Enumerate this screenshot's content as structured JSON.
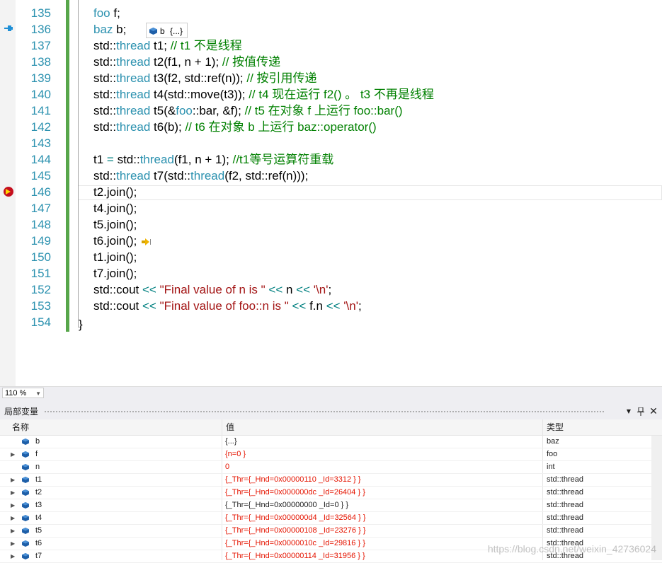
{
  "editor": {
    "lines": [
      {
        "n": "135",
        "segs": [
          {
            "t": "foo",
            "c": "kw"
          },
          {
            "t": " f;",
            "c": ""
          }
        ]
      },
      {
        "n": "136",
        "segs": [
          {
            "t": "baz",
            "c": "kw"
          },
          {
            "t": " b;",
            "c": ""
          }
        ]
      },
      {
        "n": "137",
        "segs": [
          {
            "t": "std::",
            "c": ""
          },
          {
            "t": "thread",
            "c": "kw"
          },
          {
            "t": " t1; ",
            "c": ""
          },
          {
            "t": "// t1 不是线程",
            "c": "cm"
          }
        ]
      },
      {
        "n": "138",
        "segs": [
          {
            "t": "std::",
            "c": ""
          },
          {
            "t": "thread",
            "c": "kw"
          },
          {
            "t": " t2(f1, n + 1); ",
            "c": ""
          },
          {
            "t": "// 按值传递",
            "c": "cm"
          }
        ]
      },
      {
        "n": "139",
        "segs": [
          {
            "t": "std::",
            "c": ""
          },
          {
            "t": "thread",
            "c": "kw"
          },
          {
            "t": " t3(f2, std::ref(n)); ",
            "c": ""
          },
          {
            "t": "// 按引用传递",
            "c": "cm"
          }
        ]
      },
      {
        "n": "140",
        "segs": [
          {
            "t": "std::",
            "c": ""
          },
          {
            "t": "thread",
            "c": "kw"
          },
          {
            "t": " t4(std::move(t3)); ",
            "c": ""
          },
          {
            "t": "// t4 现在运行 f2() 。 t3 不再是线程",
            "c": "cm"
          }
        ]
      },
      {
        "n": "141",
        "segs": [
          {
            "t": "std::",
            "c": ""
          },
          {
            "t": "thread",
            "c": "kw"
          },
          {
            "t": " t5(&",
            "c": ""
          },
          {
            "t": "foo",
            "c": "kw"
          },
          {
            "t": "::bar, &f); ",
            "c": ""
          },
          {
            "t": "// t5 在对象 f 上运行 foo::bar()",
            "c": "cm"
          }
        ]
      },
      {
        "n": "142",
        "segs": [
          {
            "t": "std::",
            "c": ""
          },
          {
            "t": "thread",
            "c": "kw"
          },
          {
            "t": " t6(b); ",
            "c": ""
          },
          {
            "t": "// t6 在对象 b 上运行 baz::operator()",
            "c": "cm"
          }
        ]
      },
      {
        "n": "143",
        "segs": []
      },
      {
        "n": "144",
        "segs": [
          {
            "t": "t1 ",
            "c": ""
          },
          {
            "t": "=",
            "c": "op"
          },
          {
            "t": " std::",
            "c": ""
          },
          {
            "t": "thread",
            "c": "kw"
          },
          {
            "t": "(f1, n + 1); ",
            "c": ""
          },
          {
            "t": "//t1等号运算符重载",
            "c": "cm"
          }
        ]
      },
      {
        "n": "145",
        "segs": [
          {
            "t": "std::",
            "c": ""
          },
          {
            "t": "thread",
            "c": "kw"
          },
          {
            "t": " t7(std::",
            "c": ""
          },
          {
            "t": "thread",
            "c": "kw"
          },
          {
            "t": "(f2, std::ref(n)));",
            "c": ""
          }
        ]
      },
      {
        "n": "146",
        "segs": [
          {
            "t": "t2.join();",
            "c": ""
          }
        ]
      },
      {
        "n": "147",
        "segs": [
          {
            "t": "t4.join();",
            "c": ""
          }
        ]
      },
      {
        "n": "148",
        "segs": [
          {
            "t": "t5.join();",
            "c": ""
          }
        ]
      },
      {
        "n": "149",
        "segs": [
          {
            "t": "t6.join();",
            "c": ""
          }
        ]
      },
      {
        "n": "150",
        "segs": [
          {
            "t": "t1.join();",
            "c": ""
          }
        ]
      },
      {
        "n": "151",
        "segs": [
          {
            "t": "t7.join();",
            "c": ""
          }
        ]
      },
      {
        "n": "152",
        "segs": [
          {
            "t": "std::cout ",
            "c": ""
          },
          {
            "t": "<<",
            "c": "op"
          },
          {
            "t": " ",
            "c": ""
          },
          {
            "t": "\"Final value of n is \"",
            "c": "st"
          },
          {
            "t": " ",
            "c": ""
          },
          {
            "t": "<<",
            "c": "op"
          },
          {
            "t": " n ",
            "c": ""
          },
          {
            "t": "<<",
            "c": "op"
          },
          {
            "t": " ",
            "c": ""
          },
          {
            "t": "'\\n'",
            "c": "st"
          },
          {
            "t": ";",
            "c": ""
          }
        ]
      },
      {
        "n": "153",
        "segs": [
          {
            "t": "std::cout ",
            "c": ""
          },
          {
            "t": "<<",
            "c": "op"
          },
          {
            "t": " ",
            "c": ""
          },
          {
            "t": "\"Final value of foo::n is \"",
            "c": "st"
          },
          {
            "t": " ",
            "c": ""
          },
          {
            "t": "<<",
            "c": "op"
          },
          {
            "t": " f.n ",
            "c": ""
          },
          {
            "t": "<<",
            "c": "op"
          },
          {
            "t": " ",
            "c": ""
          },
          {
            "t": "'\\n'",
            "c": "st"
          },
          {
            "t": ";",
            "c": ""
          }
        ]
      },
      {
        "n": "154",
        "segs": []
      }
    ],
    "closing_brace": "}",
    "datatip": {
      "name": "b",
      "value": "{...}"
    }
  },
  "zoom": {
    "value": "110 %"
  },
  "locals": {
    "title": "局部变量",
    "columns": {
      "name": "名称",
      "value": "值",
      "type": "类型"
    },
    "rows": [
      {
        "expand": false,
        "name": "b",
        "value": "{...}",
        "type": "baz",
        "changed": false
      },
      {
        "expand": true,
        "name": "f",
        "value": "{n=0 }",
        "type": "foo",
        "changed": true
      },
      {
        "expand": false,
        "name": "n",
        "value": "0",
        "type": "int",
        "changed": true
      },
      {
        "expand": true,
        "name": "t1",
        "value": "{_Thr={_Hnd=0x00000110 _Id=3312 } }",
        "type": "std::thread",
        "changed": true
      },
      {
        "expand": true,
        "name": "t2",
        "value": "{_Thr={_Hnd=0x000000dc _Id=26404 } }",
        "type": "std::thread",
        "changed": true
      },
      {
        "expand": true,
        "name": "t3",
        "value": "{_Thr={_Hnd=0x00000000 _Id=0 } }",
        "type": "std::thread",
        "changed": false
      },
      {
        "expand": true,
        "name": "t4",
        "value": "{_Thr={_Hnd=0x000000d4 _Id=32564 } }",
        "type": "std::thread",
        "changed": true
      },
      {
        "expand": true,
        "name": "t5",
        "value": "{_Thr={_Hnd=0x00000108 _Id=23276 } }",
        "type": "std::thread",
        "changed": true
      },
      {
        "expand": true,
        "name": "t6",
        "value": "{_Thr={_Hnd=0x0000010c _Id=29816 } }",
        "type": "std::thread",
        "changed": true
      },
      {
        "expand": true,
        "name": "t7",
        "value": "{_Thr={_Hnd=0x00000114 _Id=31956 } }",
        "type": "std::thread",
        "changed": true
      }
    ]
  },
  "watermark": "https://blog.csdn.net/weixin_42736024",
  "colors": {
    "changed_value": "#e51400",
    "keyword": "#2b91af",
    "comment": "#008000",
    "string": "#a31515"
  }
}
